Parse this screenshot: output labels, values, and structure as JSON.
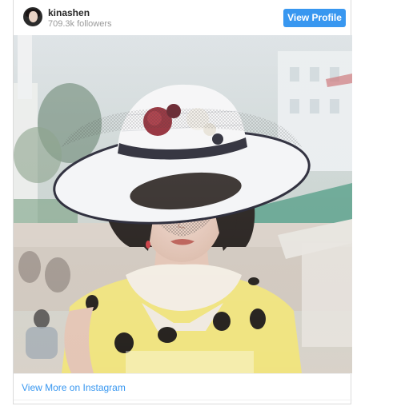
{
  "header": {
    "username": "kinashen",
    "followers": "709.3k followers",
    "view_profile_label": "View Profile"
  },
  "footer": {
    "view_more_label": "View More on Instagram"
  },
  "colors": {
    "accent": "#3897f0",
    "username": "#262626",
    "muted": "#999999"
  },
  "icons": {
    "avatar": "profile-avatar"
  }
}
